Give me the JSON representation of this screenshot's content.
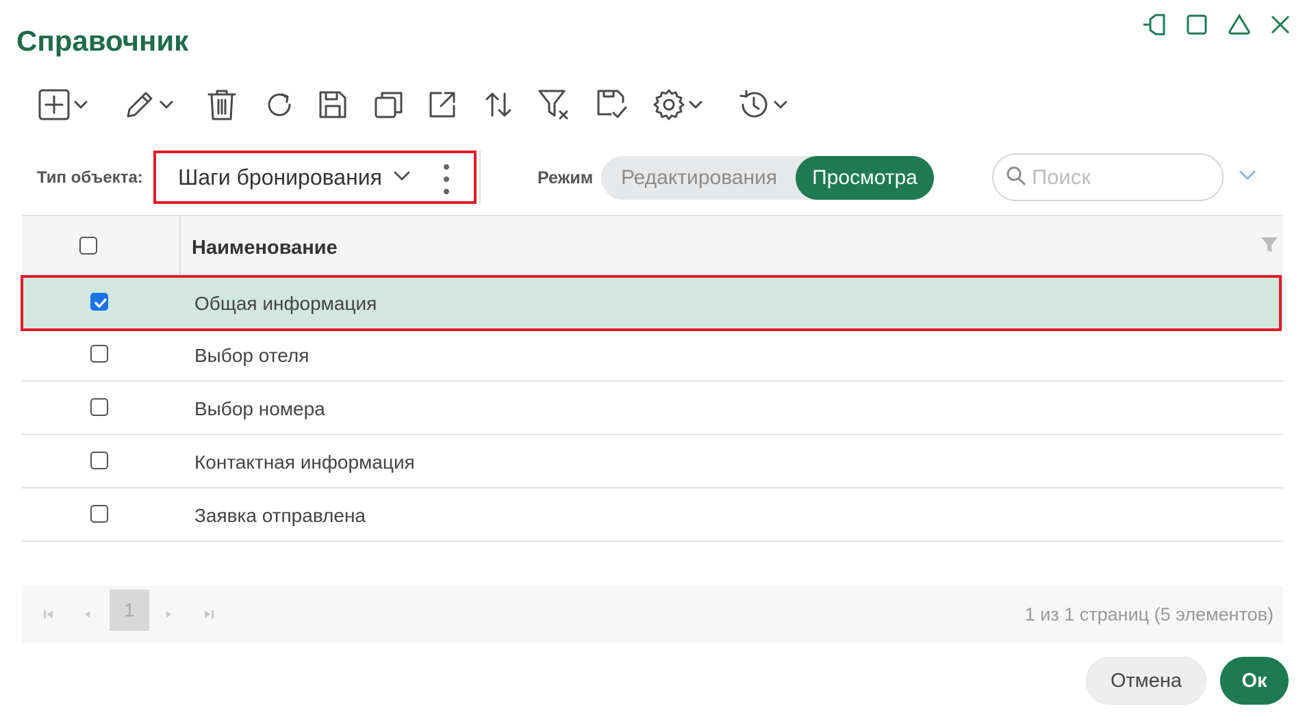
{
  "window": {
    "title": "Справочник",
    "controls": [
      "pin-icon",
      "maximize-icon",
      "collapse-icon",
      "close-icon"
    ]
  },
  "toolbar": {
    "icons": [
      "add-icon",
      "edit-icon",
      "delete-icon",
      "refresh-icon",
      "save-icon",
      "copy-icon",
      "export-icon",
      "sort-icon",
      "clear-filter-icon",
      "save-layout-icon",
      "settings-icon",
      "history-icon"
    ]
  },
  "filters": {
    "object_type_label": "Тип объекта:",
    "object_type_value": "Шаги бронирования",
    "mode_label": "Режим",
    "mode_edit": "Редактирования",
    "mode_view": "Просмотра",
    "mode_active": "view",
    "search_placeholder": "Поиск"
  },
  "grid": {
    "header": "Наименование",
    "rows": [
      {
        "name": "Общая информация",
        "checked": true
      },
      {
        "name": "Выбор отеля",
        "checked": false
      },
      {
        "name": "Выбор номера",
        "checked": false
      },
      {
        "name": "Контактная информация",
        "checked": false
      },
      {
        "name": "Заявка отправлена",
        "checked": false
      }
    ]
  },
  "pager": {
    "current_page": "1",
    "info": "1 из 1 страниц (5 элементов)"
  },
  "footer": {
    "cancel_label": "Отмена",
    "ok_label": "Ок"
  },
  "colors": {
    "accent": "#1e7a54",
    "selected_row": "#d1e7df",
    "highlight_outline": "#e11b2b",
    "checkbox_checked": "#1a73e8"
  }
}
